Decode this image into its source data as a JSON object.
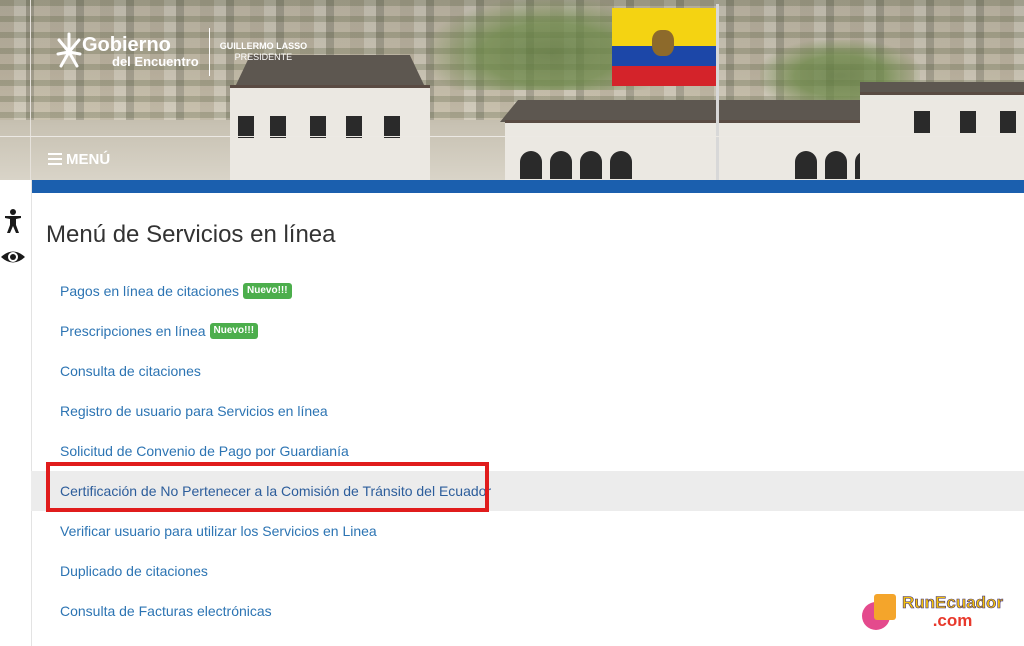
{
  "header": {
    "logo_line1": "Gobierno",
    "logo_line2": "del Encuentro",
    "president_name": "GUILLERMO LASSO",
    "president_title": "PRESIDENTE",
    "menu_label": "MENÚ"
  },
  "colors": {
    "accent_blue": "#1b5fae",
    "link": "#2c74b3",
    "badge_green": "#4cae4c",
    "highlight_border": "#e01c1c"
  },
  "sidebar": {
    "accessibility_icon": "accessibility-icon",
    "visibility_icon": "eye-icon"
  },
  "main": {
    "title": "Menú de Servicios en línea",
    "items": [
      {
        "label": "Pagos en línea de citaciones",
        "badge": "Nuevo!!!"
      },
      {
        "label": "Prescripciones en línea",
        "badge": "Nuevo!!!"
      },
      {
        "label": "Consulta de citaciones"
      },
      {
        "label": "Registro de usuario para Servicios en línea"
      },
      {
        "label": "Solicitud de Convenio de Pago por Guardianía"
      },
      {
        "label": "Certificación de No Pertenecer a la Comisión de Tránsito del Ecuador"
      },
      {
        "label": "Verificar usuario para utilizar los Servicios en Linea"
      },
      {
        "label": "Duplicado de citaciones"
      },
      {
        "label": "Consulta de Facturas electrónicas"
      }
    ]
  },
  "watermark": {
    "line1": "RunEcuador",
    "line2": ".com"
  }
}
